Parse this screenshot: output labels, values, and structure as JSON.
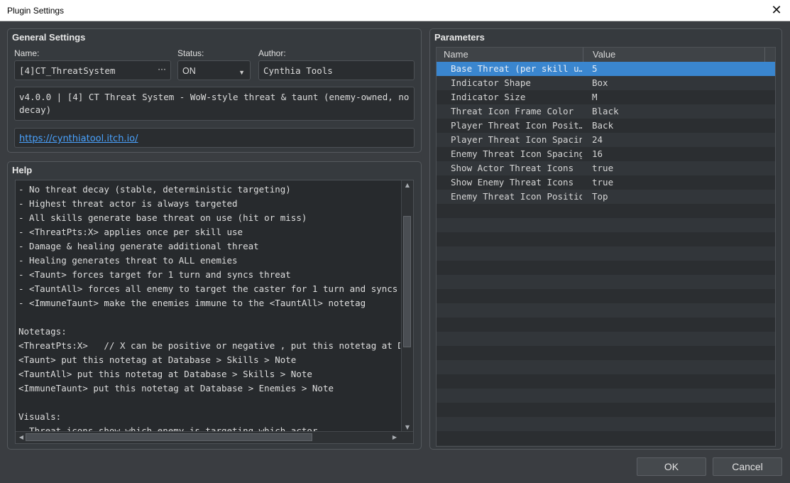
{
  "window": {
    "title": "Plugin Settings",
    "close_glyph": "✕"
  },
  "general": {
    "heading": "General Settings",
    "name_label": "Name:",
    "name_value": "[4]CT_ThreatSystem",
    "name_browse": "···",
    "status_label": "Status:",
    "status_value": "ON",
    "author_label": "Author:",
    "author_value": "Cynthia Tools",
    "description": "v4.0.0 | [4] CT Threat System - WoW-style threat & taunt (enemy-owned, no decay)",
    "url": "https://cynthiatool.itch.io/"
  },
  "help": {
    "heading": "Help",
    "text": "- No threat decay (stable, deterministic targeting)\n- Highest threat actor is always targeted\n- All skills generate base threat on use (hit or miss)\n- <ThreatPts:X> applies once per skill use\n- Damage & healing generate additional threat\n- Healing generates threat to ALL enemies\n- <Taunt> forces target for 1 turn and syncs threat\n- <TauntAll> forces all enemy to target the caster for 1 turn and syncs threat\n- <ImmuneTaunt> make the enemies immune to the <TauntAll> notetag\n\nNotetags:\n<ThreatPts:X>   // X can be positive or negative , put this notetag at Database > Skills > Note\n<Taunt> put this notetag at Database > Skills > Note\n<TauntAll> put this notetag at Database > Skills > Note\n<ImmuneTaunt> put this notetag at Database > Enemies > Note\n\nVisuals:\n- Threat icons show which enemy is targeting which actor"
  },
  "parameters": {
    "heading": "Parameters",
    "col_name": "Name",
    "col_value": "Value",
    "rows": [
      {
        "name": "Base Threat (per skill u…",
        "value": "5"
      },
      {
        "name": "Indicator Shape",
        "value": "Box"
      },
      {
        "name": "Indicator Size",
        "value": "M"
      },
      {
        "name": "Threat Icon Frame Color",
        "value": "Black"
      },
      {
        "name": "Player Threat Icon Posit…",
        "value": "Back"
      },
      {
        "name": "Player Threat Icon Spacing",
        "value": "24"
      },
      {
        "name": "Enemy Threat Icon Spacing",
        "value": "16"
      },
      {
        "name": "Show Actor Threat Icons",
        "value": "true"
      },
      {
        "name": "Show Enemy Threat Icons",
        "value": "true"
      },
      {
        "name": "Enemy Threat Icon Position",
        "value": "Top"
      }
    ]
  },
  "buttons": {
    "ok": "OK",
    "cancel": "Cancel"
  }
}
